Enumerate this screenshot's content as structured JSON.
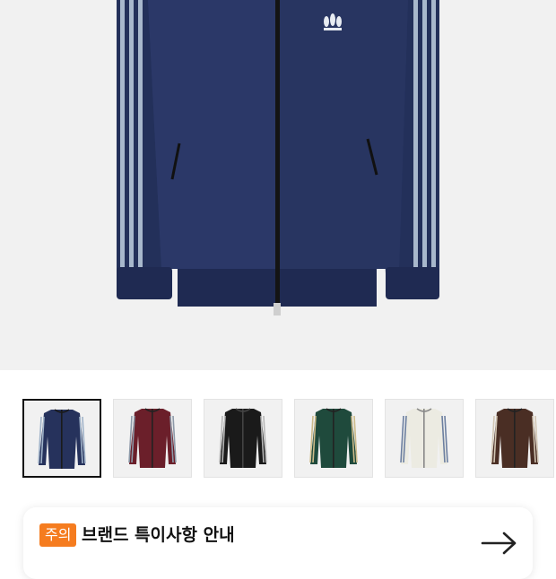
{
  "product": {
    "thumbnails": [
      {
        "color_name": "navy",
        "body": "#26325c",
        "stripe": "#9fb2c8",
        "zip": "#1a1a1a",
        "selected": true
      },
      {
        "color_name": "burgundy",
        "body": "#6b1f2a",
        "stripe": "#8d99a8",
        "zip": "#222",
        "selected": false
      },
      {
        "color_name": "black",
        "body": "#1a1a1a",
        "stripe": "#b7b7b7",
        "zip": "#444",
        "selected": false
      },
      {
        "color_name": "dark-green",
        "body": "#1f4a3c",
        "stripe": "#cdbb8a",
        "zip": "#222",
        "selected": false
      },
      {
        "color_name": "cream",
        "body": "#ecebe2",
        "stripe": "#6c7fa0",
        "zip": "#888",
        "selected": false
      },
      {
        "color_name": "brown",
        "body": "#4a2e24",
        "stripe": "#d2c6b4",
        "zip": "#222",
        "selected": false
      }
    ]
  },
  "notice": {
    "badge": "주의",
    "title": "브랜드 특이사항 안내",
    "badge_color": "#f57c1f"
  },
  "icons": {
    "next": "arrow-right-icon",
    "logo": "trefoil-logo-icon"
  }
}
